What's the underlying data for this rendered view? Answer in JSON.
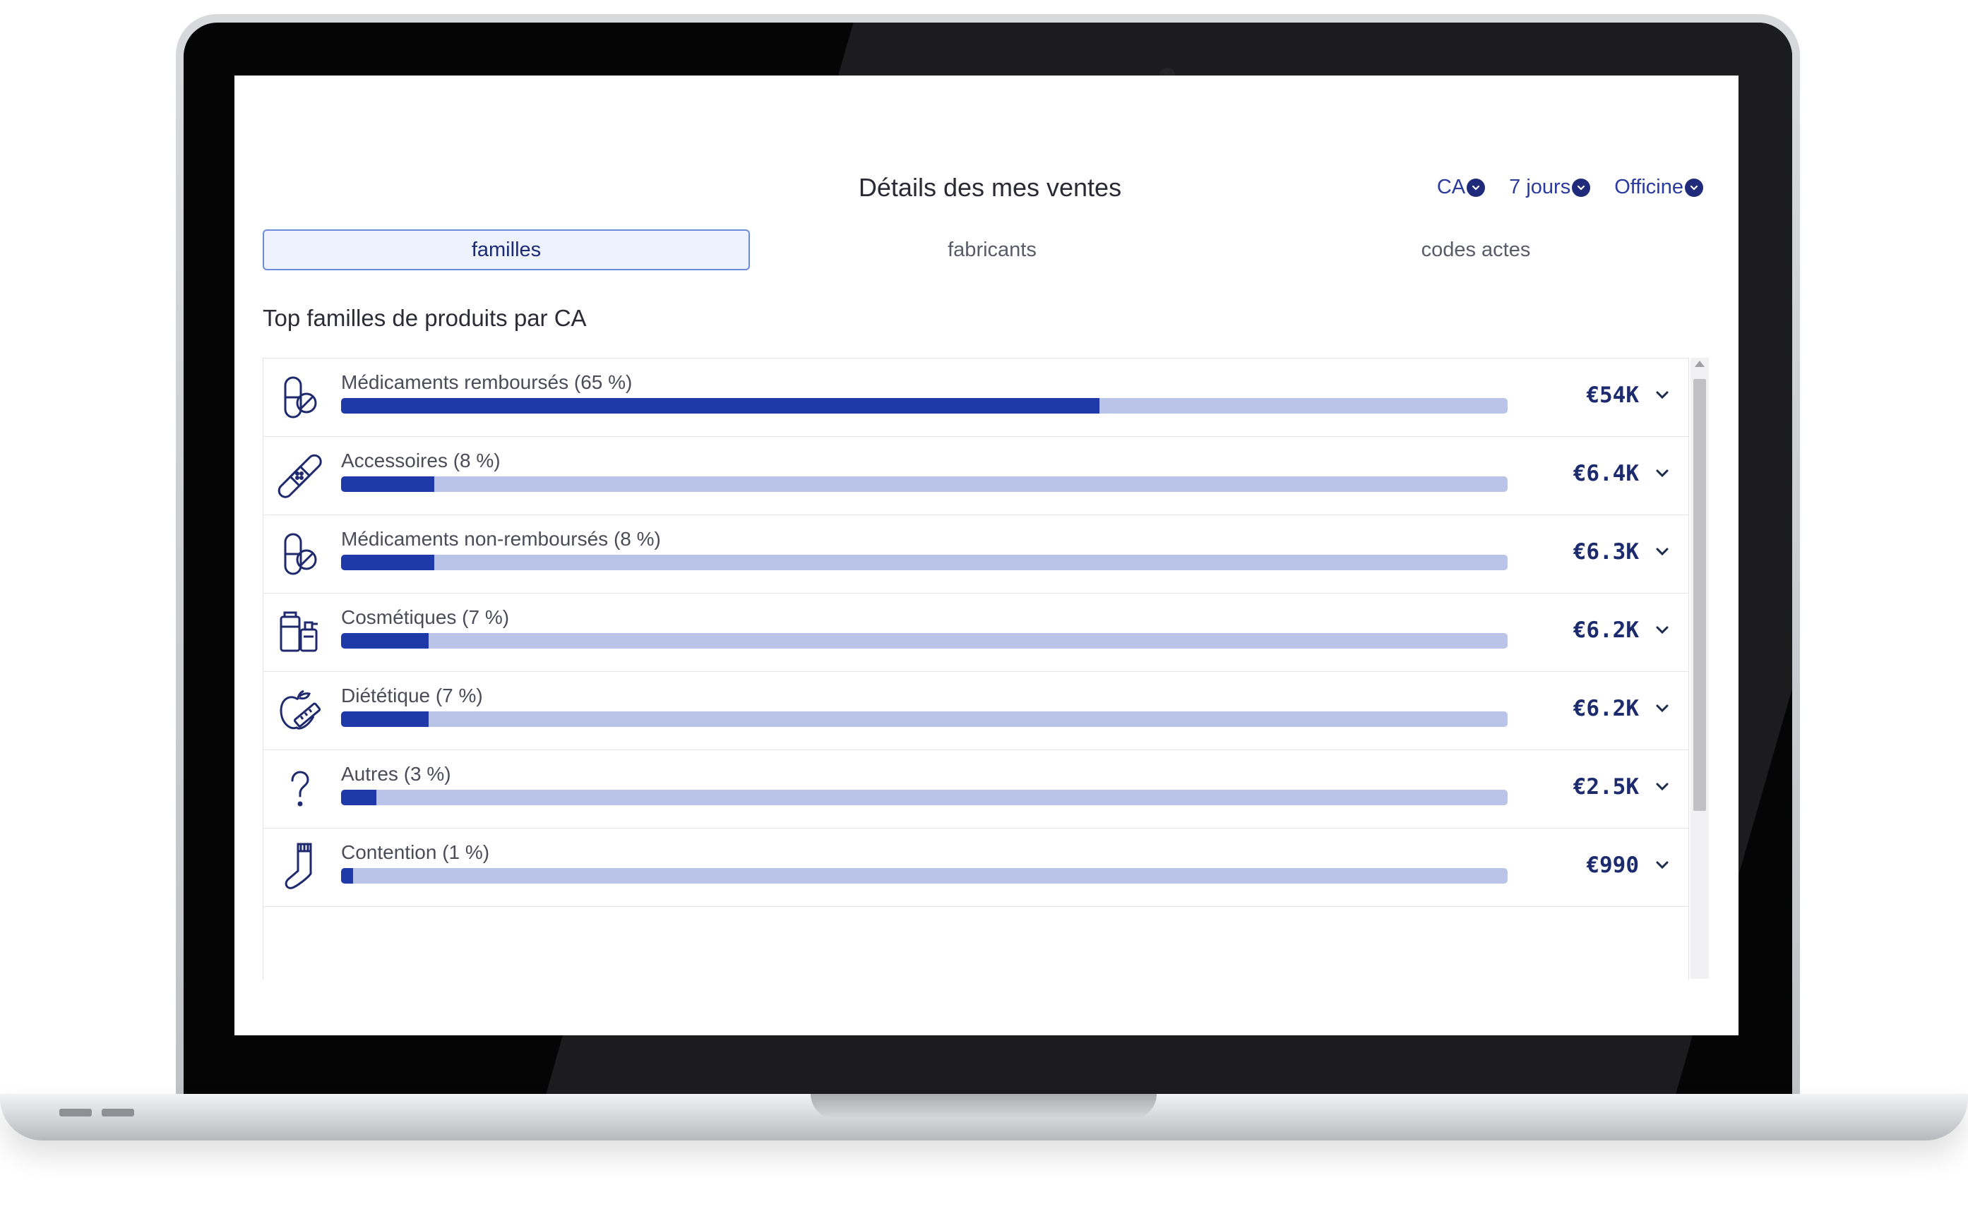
{
  "header": {
    "title": "Détails des mes ventes"
  },
  "filters": [
    {
      "label": "CA"
    },
    {
      "label": "7 jours"
    },
    {
      "label": "Officine"
    }
  ],
  "tabs": [
    {
      "label": "familles",
      "active": true
    },
    {
      "label": "fabricants",
      "active": false
    },
    {
      "label": "codes actes",
      "active": false
    }
  ],
  "section": {
    "title": "Top familles de produits par CA"
  },
  "rows": [
    {
      "label": "Médicaments remboursés (65 %)",
      "value": "€54K",
      "share": 0.65,
      "icon": "pill-icon"
    },
    {
      "label": "Accessoires (8 %)",
      "value": "€6.4K",
      "share": 0.08,
      "icon": "bandage-icon"
    },
    {
      "label": "Médicaments non-remboursés (8 %)",
      "value": "€6.3K",
      "share": 0.08,
      "icon": "pill-icon"
    },
    {
      "label": "Cosmétiques (7 %)",
      "value": "€6.2K",
      "share": 0.075,
      "icon": "cosmetics-bottles-icon"
    },
    {
      "label": "Diététique (7 %)",
      "value": "€6.2K",
      "share": 0.075,
      "icon": "apple-tape-measure-icon"
    },
    {
      "label": "Autres (3 %)",
      "value": "€2.5K",
      "share": 0.03,
      "icon": "question-mark-icon"
    },
    {
      "label": "Contention (1 %)",
      "value": "€990",
      "share": 0.01,
      "icon": "sock-icon"
    }
  ],
  "colors": {
    "accent": "#1f3aa8",
    "track": "#b9c4e8",
    "tab_active_bg": "#edf2fd",
    "text_value": "#1c2a6e"
  }
}
